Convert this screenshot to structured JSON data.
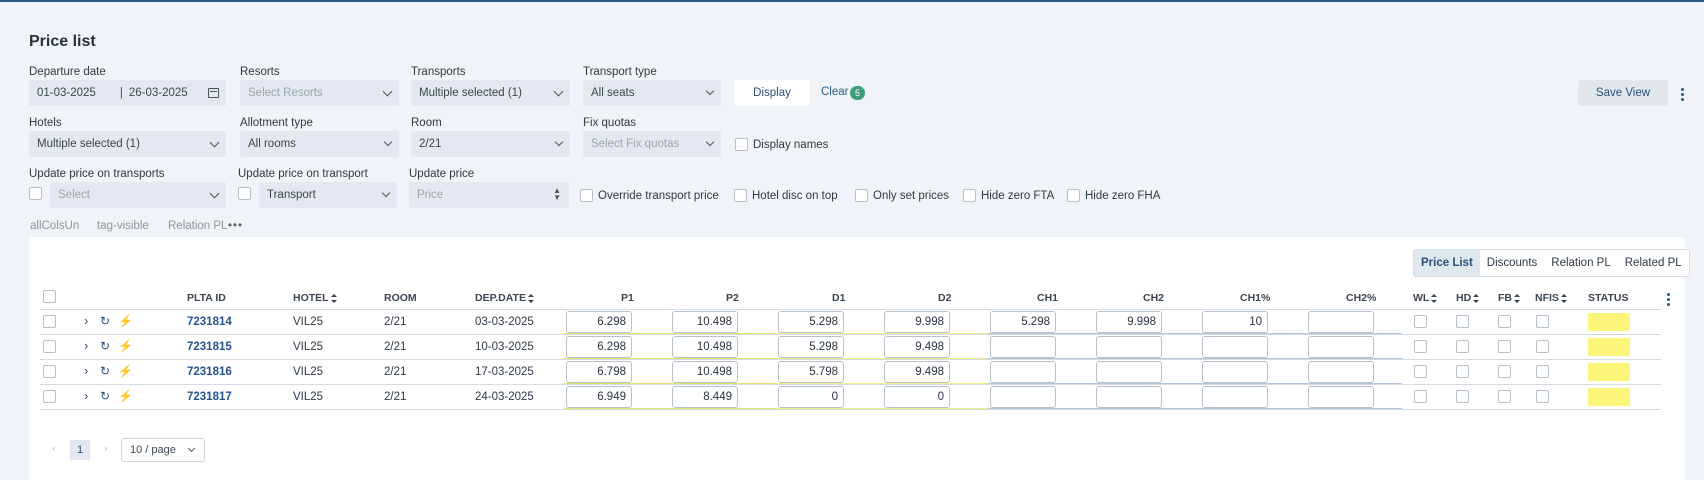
{
  "page_title": "Price list",
  "filters": {
    "departure_date": {
      "label": "Departure date",
      "from": "01-03-2025",
      "sep": "|",
      "to": "26-03-2025"
    },
    "resorts": {
      "label": "Resorts",
      "placeholder": "Select Resorts"
    },
    "transports": {
      "label": "Transports",
      "value": "Multiple selected (1)"
    },
    "transport_type": {
      "label": "Transport type",
      "value": "All seats"
    },
    "hotels": {
      "label": "Hotels",
      "value": "Multiple selected (1)"
    },
    "allotment_type": {
      "label": "Allotment type",
      "value": "All rooms"
    },
    "room": {
      "label": "Room",
      "value": "2/21"
    },
    "fix_quotas": {
      "label": "Fix quotas",
      "placeholder": "Select Fix quotas"
    },
    "display_names": "Display names",
    "update_price_transports": {
      "label": "Update price on transports",
      "placeholder": "Select"
    },
    "update_price_transport": {
      "label": "Update price on transport",
      "value": "Transport"
    },
    "update_price": {
      "label": "Update price",
      "placeholder": "Price"
    },
    "options": [
      "Override transport price",
      "Hotel disc on top",
      "Only set prices",
      "Hide zero FTA",
      "Hide zero FHA"
    ]
  },
  "actions": {
    "display": "Display",
    "clear": "Clear",
    "clear_count": "5",
    "save_view": "Save View"
  },
  "tags": [
    "allColsUn",
    "tag-visible",
    "Relation PL"
  ],
  "view_tabs": [
    "Price List",
    "Discounts",
    "Relation PL",
    "Related PL"
  ],
  "table": {
    "columns": [
      "PLTA ID",
      "HOTEL",
      "ROOM",
      "DEP.DATE",
      "P1",
      "P2",
      "D1",
      "D2",
      "CH1",
      "CH2",
      "CH1%",
      "CH2%",
      "WL",
      "HD",
      "FB",
      "NFIS",
      "STATUS"
    ],
    "rows": [
      {
        "id": "7231814",
        "hotel": "VIL25",
        "room": "2/21",
        "date": "03-03-2025",
        "p1": "6.298",
        "p2": "10.498",
        "d1": "5.298",
        "d2": "9.998",
        "ch1": "5.298",
        "ch2": "9.998",
        "ch1p": "10",
        "ch2p": ""
      },
      {
        "id": "7231815",
        "hotel": "VIL25",
        "room": "2/21",
        "date": "10-03-2025",
        "p1": "6.298",
        "p2": "10.498",
        "d1": "5.298",
        "d2": "9.498",
        "ch1": "",
        "ch2": "",
        "ch1p": "",
        "ch2p": ""
      },
      {
        "id": "7231816",
        "hotel": "VIL25",
        "room": "2/21",
        "date": "17-03-2025",
        "p1": "6.798",
        "p2": "10.498",
        "d1": "5.798",
        "d2": "9.498",
        "ch1": "",
        "ch2": "",
        "ch1p": "",
        "ch2p": ""
      },
      {
        "id": "7231817",
        "hotel": "VIL25",
        "room": "2/21",
        "date": "24-03-2025",
        "p1": "6.949",
        "p2": "8.449",
        "d1": "0",
        "d2": "0",
        "ch1": "",
        "ch2": "",
        "ch1p": "",
        "ch2p": ""
      }
    ]
  },
  "pagination": {
    "current": "1",
    "page_size": "10 / page"
  },
  "colors": {
    "accent": "#24548a",
    "status_yellow": "#fbf67a",
    "badge_green": "#3e9e7a"
  }
}
